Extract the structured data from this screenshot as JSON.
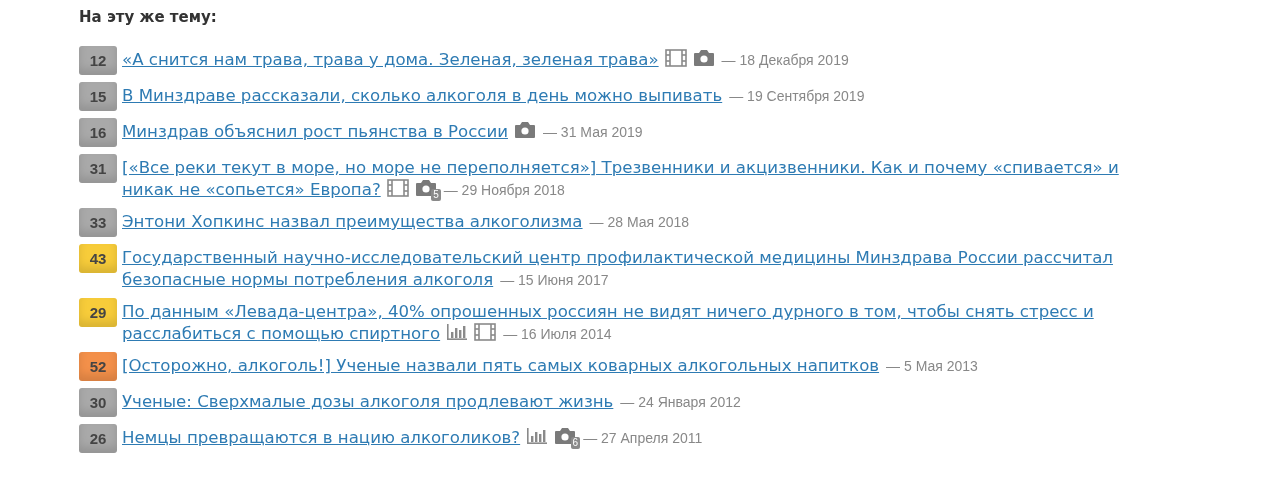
{
  "heading": "На эту же тему:",
  "articles": [
    {
      "count": "12",
      "color": "#a9a9a9",
      "title_lines": [
        "«А снится нам трава, трава у дома. Зеленая, зеленая трава»"
      ],
      "media": [
        {
          "kind": "film"
        },
        {
          "kind": "camera"
        }
      ],
      "date": "— 18 Декабря 2019"
    },
    {
      "count": "15",
      "color": "#a9a9a9",
      "title_lines": [
        "В Минздраве рассказали, сколько алкоголя в день можно выпивать"
      ],
      "date": "— 19 Сентября 2019"
    },
    {
      "count": "16",
      "color": "#a9a9a9",
      "title_lines": [
        "Минздрав объяснил рост пьянства в России"
      ],
      "media": [
        {
          "kind": "camera"
        }
      ],
      "date": "— 31 Мая 2019"
    },
    {
      "count": "31",
      "color": "#a9a9a9",
      "title_lines": [
        "[«Все реки текут в море, но море не переполняется»] Трезвенники и акцизвенники. Как и почему «спивается» и",
        "никак не «сопьется» Европа?"
      ],
      "media": [
        {
          "kind": "film"
        },
        {
          "kind": "camera",
          "count": "5"
        }
      ],
      "date": "— 29 Ноября 2018"
    },
    {
      "count": "33",
      "color": "#a9a9a9",
      "title_lines": [
        "Энтони Хопкинс назвал преимущества алкоголизма"
      ],
      "date": "— 28 Мая 2018"
    },
    {
      "count": "43",
      "color": "#f7cc3a",
      "title_lines": [
        "Государственный научно-исследовательский центр профилактической медицины Минздрава России рассчитал",
        "безопасные нормы потребления алкоголя"
      ],
      "date": "— 15 Июня 2017"
    },
    {
      "count": "29",
      "color": "#f7cc3a",
      "title_lines": [
        "По данным «Левада-центра», 40% опрошенных россиян не видят ничего дурного в том, чтобы снять стресс и",
        "расслабиться с помощью спиртного"
      ],
      "media": [
        {
          "kind": "chart"
        },
        {
          "kind": "film"
        }
      ],
      "date": "— 16 Июля 2014"
    },
    {
      "count": "52",
      "color": "#f3904a",
      "title_lines": [
        "[Осторожно, алкоголь!] Ученые назвали пять самых коварных алкогольных напитков"
      ],
      "date": "— 5 Мая 2013"
    },
    {
      "count": "30",
      "color": "#a9a9a9",
      "title_lines": [
        "Ученые: Сверхмалые дозы алкоголя продлевают жизнь"
      ],
      "date": "— 24 Января 2012"
    },
    {
      "count": "26",
      "color": "#a9a9a9",
      "title_lines": [
        "Немцы превращаются в нацию алкоголиков?"
      ],
      "media": [
        {
          "kind": "chart"
        },
        {
          "kind": "camera",
          "count": "6"
        }
      ],
      "date": "— 27 Апреля 2011"
    }
  ]
}
